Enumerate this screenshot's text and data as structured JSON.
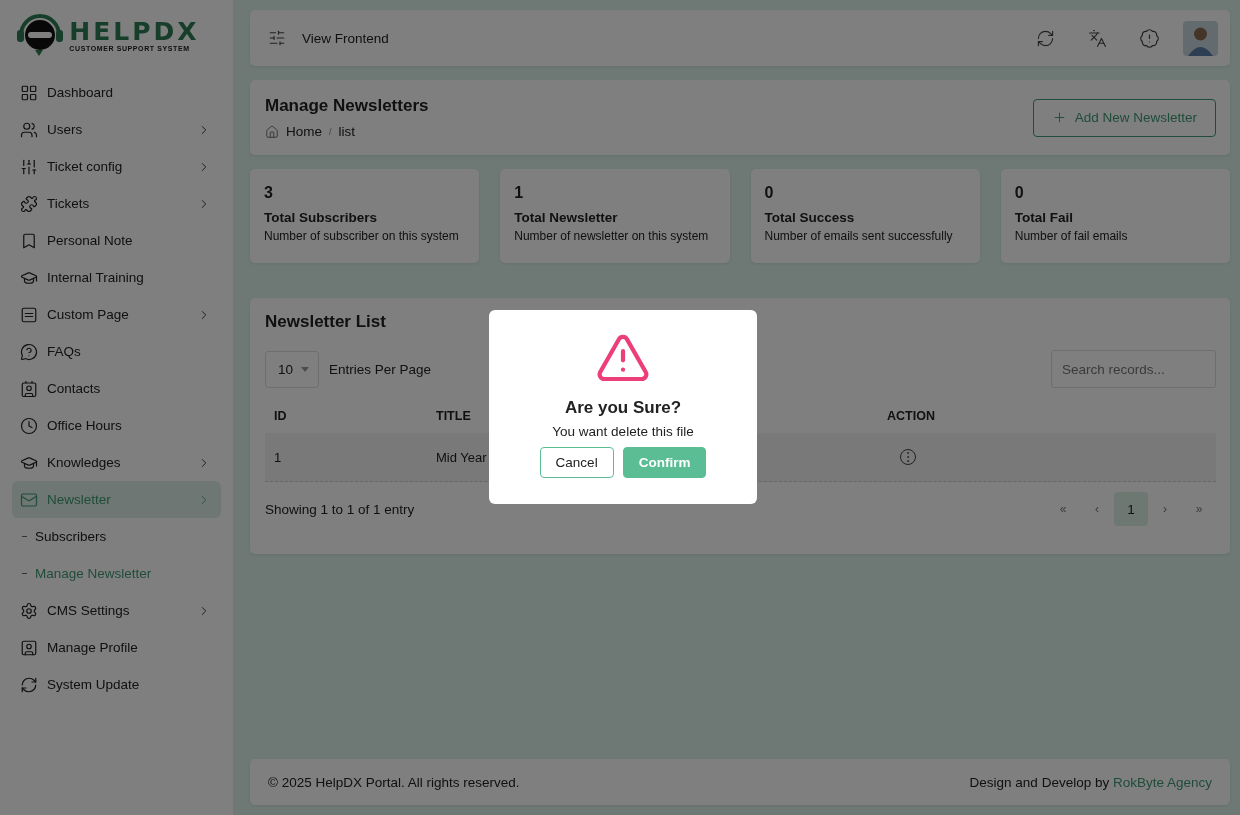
{
  "sidebar": {
    "logo": {
      "name": "HELPDX",
      "tagline": "CUSTOMER SUPPORT SYSTEM"
    },
    "items": [
      {
        "label": "Dashboard",
        "expandable": false,
        "selected": false
      },
      {
        "label": "Users",
        "expandable": true,
        "selected": false
      },
      {
        "label": "Ticket config",
        "expandable": true,
        "selected": false
      },
      {
        "label": "Tickets",
        "expandable": true,
        "selected": false
      },
      {
        "label": "Personal Note",
        "expandable": false,
        "selected": false
      },
      {
        "label": "Internal Training",
        "expandable": false,
        "selected": false
      },
      {
        "label": "Custom Page",
        "expandable": true,
        "selected": false
      },
      {
        "label": "FAQs",
        "expandable": false,
        "selected": false
      },
      {
        "label": "Contacts",
        "expandable": false,
        "selected": false
      },
      {
        "label": "Office Hours",
        "expandable": false,
        "selected": false
      },
      {
        "label": "Knowledges",
        "expandable": true,
        "selected": false
      },
      {
        "label": "Newsletter",
        "expandable": true,
        "selected": true,
        "children": [
          {
            "label": "Subscribers",
            "selected": false
          },
          {
            "label": "Manage Newsletter",
            "selected": true
          }
        ]
      },
      {
        "label": "CMS Settings",
        "expandable": true,
        "selected": false
      },
      {
        "label": "Manage Profile",
        "expandable": false,
        "selected": false
      },
      {
        "label": "System Update",
        "expandable": false,
        "selected": false
      }
    ]
  },
  "topbar": {
    "link": "View Frontend"
  },
  "page_header": {
    "title": "Manage Newsletters",
    "breadcrumb": {
      "items": [
        "Home",
        "list"
      ],
      "separator": "/"
    },
    "add_button": "Add New Newsletter"
  },
  "stats": [
    {
      "value": "3",
      "title": "Total Subscribers",
      "description": "Number of subscriber on this system"
    },
    {
      "value": "1",
      "title": "Total Newsletter",
      "description": "Number of newsletter on this system"
    },
    {
      "value": "0",
      "title": "Total Success",
      "description": "Number of emails sent successfully"
    },
    {
      "value": "0",
      "title": "Total Fail",
      "description": "Number of fail emails"
    }
  ],
  "newsletter_list": {
    "title": "Newsletter List",
    "entries_select": "10",
    "entries_label": "Entries Per Page",
    "search": {
      "placeholder": "Search records..."
    },
    "columns": [
      "ID",
      "TITLE",
      "ACTION"
    ],
    "rows": [
      {
        "id": "1",
        "title": "Mid Year"
      }
    ],
    "summary": "Showing 1 to 1 of 1 entry",
    "pagination": [
      {
        "label": "«",
        "selected": false
      },
      {
        "label": "‹",
        "selected": false
      },
      {
        "label": "1",
        "selected": true
      },
      {
        "label": "›",
        "selected": false
      },
      {
        "label": "»",
        "selected": false
      }
    ]
  },
  "footer": {
    "copyright": "© 2025 HelpDX Portal. All rights reserved.",
    "credit": "Design and Develop by",
    "credit_link": "RokByte Agency"
  },
  "dialog": {
    "title": "Are you Sure?",
    "message": "You want delete this file",
    "buttons": [
      {
        "label": "Cancel",
        "kind": "secondary"
      },
      {
        "label": "Confirm",
        "kind": "primary"
      }
    ]
  }
}
